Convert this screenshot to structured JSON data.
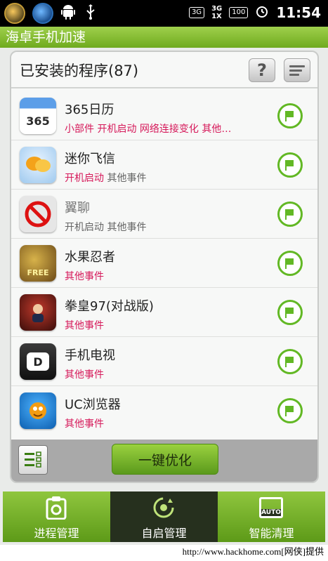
{
  "status_bar": {
    "network_badge": "3G",
    "signal_top": "3G",
    "signal_bottom": "1X",
    "battery": "100",
    "time": "11:54"
  },
  "app_title": "海卓手机加速",
  "header": {
    "title": "已安装的程序(87)",
    "help_label": "?"
  },
  "apps": [
    {
      "name": "365日历",
      "icon": "calendar-icon",
      "icon_text": "365",
      "events_red": "小部件 开机启动 网络连接变化 其他…",
      "events_gray": "",
      "muted": false
    },
    {
      "name": "迷你飞信",
      "icon": "chat-bubbles-icon",
      "icon_text": "",
      "events_red": "开机启动",
      "events_gray": "其他事件",
      "muted": false
    },
    {
      "name": "翼聊",
      "icon": "blocked-icon",
      "icon_text": "",
      "events_red": "",
      "events_gray": "开机启动 其他事件",
      "muted": true
    },
    {
      "name": "水果忍者",
      "icon": "fruit-ninja-icon",
      "icon_text": "FREE",
      "events_red": "其他事件",
      "events_gray": "",
      "muted": false
    },
    {
      "name": "拳皇97(对战版)",
      "icon": "fighter-icon",
      "icon_text": "",
      "events_red": "其他事件",
      "events_gray": "",
      "muted": false
    },
    {
      "name": "手机电视",
      "icon": "tv-icon",
      "icon_text": "D",
      "events_red": "其他事件",
      "events_gray": "",
      "muted": false
    },
    {
      "name": "UC浏览器",
      "icon": "uc-browser-icon",
      "icon_text": "",
      "events_red": "其他事件",
      "events_gray": "",
      "muted": false
    }
  ],
  "footer": {
    "optimize_label": "一键优化"
  },
  "tabs": [
    {
      "label": "进程管理",
      "icon": "clipboard-icon",
      "active": false
    },
    {
      "label": "自启管理",
      "icon": "autostart-icon",
      "active": true
    },
    {
      "label": "智能清理",
      "icon": "auto-icon",
      "icon_text": "AUTO",
      "active": false
    }
  ],
  "watermark": "http://www.hackhome.com[网侠]提供",
  "colors": {
    "accent_green": "#7cb82a",
    "event_red": "#d6195a",
    "active_tab": "#26301e"
  }
}
